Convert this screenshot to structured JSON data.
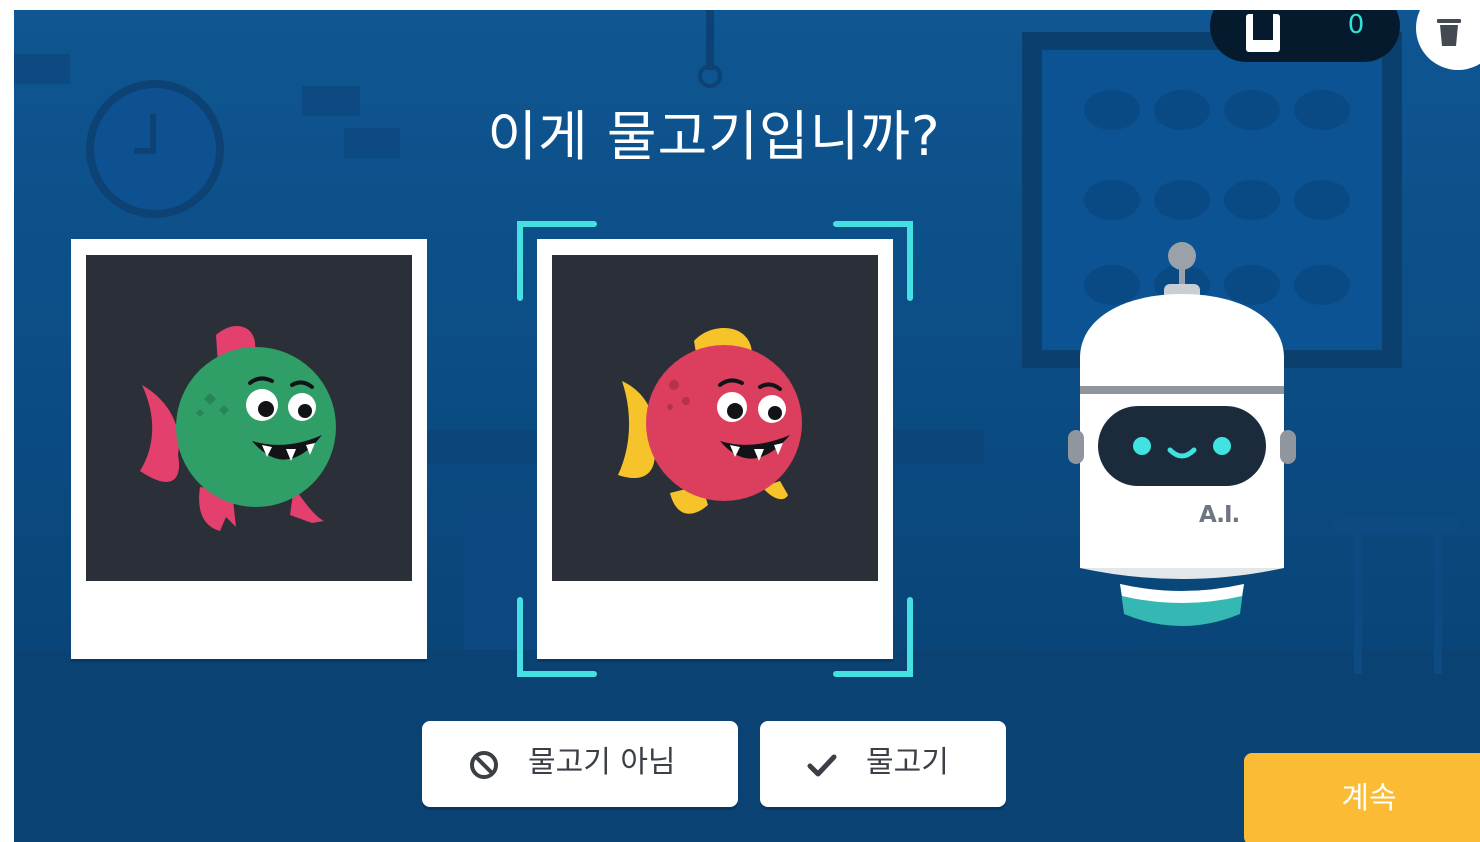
{
  "game": {
    "question": "이게 물고기입니까?",
    "counter": {
      "value": "0",
      "icon": "card-icon"
    },
    "trash_icon": "trash-icon"
  },
  "photos": [
    {
      "subject": "green-fish",
      "body_color": "#2f9e67",
      "fin_color": "#e4406e"
    },
    {
      "subject": "red-fish",
      "body_color": "#dc3f5e",
      "fin_color": "#f6c42a",
      "selected": true
    }
  ],
  "robot": {
    "label": "A.I.",
    "eye_color": "#3fe3e0"
  },
  "buttons": {
    "not_fish": {
      "label": "물고기 아님",
      "icon": "block-icon"
    },
    "fish": {
      "label": "물고기",
      "icon": "check-icon"
    },
    "continue": {
      "label": "계속"
    }
  },
  "colors": {
    "background": "#0b4f8a",
    "accent_teal": "#46e0e3",
    "continue": "#fbbb35"
  }
}
